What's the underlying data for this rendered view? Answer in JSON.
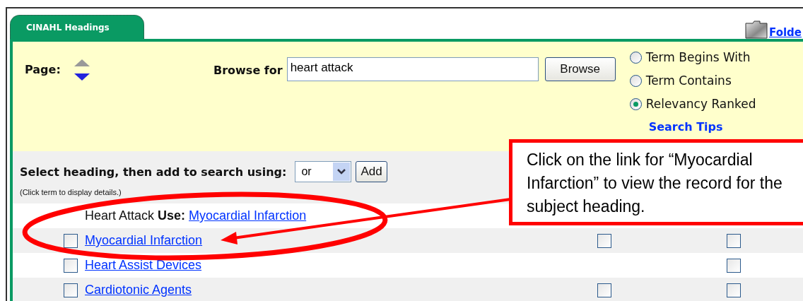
{
  "tab": {
    "label": "CINAHL Headings",
    "selected": true
  },
  "folder_link": "Folde",
  "page_label": "Page:",
  "browse": {
    "label": "Browse for",
    "value": "heart attack",
    "button": "Browse"
  },
  "search_modes": [
    {
      "label": "Term Begins With",
      "selected": false
    },
    {
      "label": "Term Contains",
      "selected": false
    },
    {
      "label": "Relevancy Ranked",
      "selected": true
    }
  ],
  "search_tips": "Search Tips",
  "combine": {
    "label": "Select heading, then add to search using:",
    "operator": "or",
    "button": "Add"
  },
  "hint": "(Click term to display details.)",
  "results": [
    {
      "kind": "use_reference",
      "term": "Heart Attack",
      "use_label": "Use:",
      "target": "Myocardial Infarction"
    },
    {
      "kind": "heading",
      "term": "Myocardial Infarction",
      "checked": false,
      "column_2_checked": false,
      "column_3_checked": false
    },
    {
      "kind": "heading",
      "term": "Heart Assist Devices",
      "checked": false,
      "column_3_checked": false
    },
    {
      "kind": "heading",
      "term": "Cardiotonic Agents",
      "checked": false,
      "column_2_checked": false,
      "column_3_checked": false
    }
  ],
  "callout": {
    "text": "Click on the link for “Myocardial Infarction” to view the record for the subject heading."
  }
}
